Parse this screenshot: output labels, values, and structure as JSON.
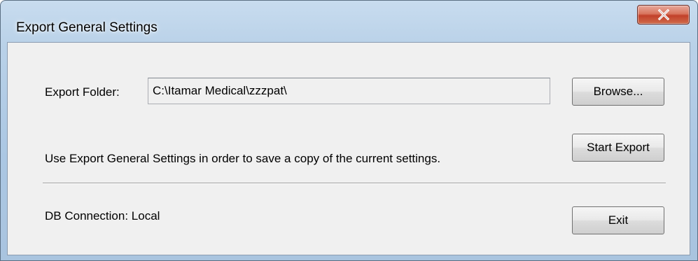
{
  "window": {
    "title": "Export General Settings",
    "close_icon": "close-x-icon"
  },
  "export_folder": {
    "label": "Export Folder:",
    "value": "C:\\Itamar Medical\\zzzpat\\"
  },
  "buttons": {
    "browse": "Browse...",
    "start_export": "Start Export",
    "exit": "Exit"
  },
  "description": "Use Export General Settings in order to save a copy of the current settings.",
  "db_connection": "DB Connection: Local",
  "colors": {
    "close_button": "#c2412a",
    "client_background": "#f0f0f0",
    "frame": "#abc7e3"
  }
}
